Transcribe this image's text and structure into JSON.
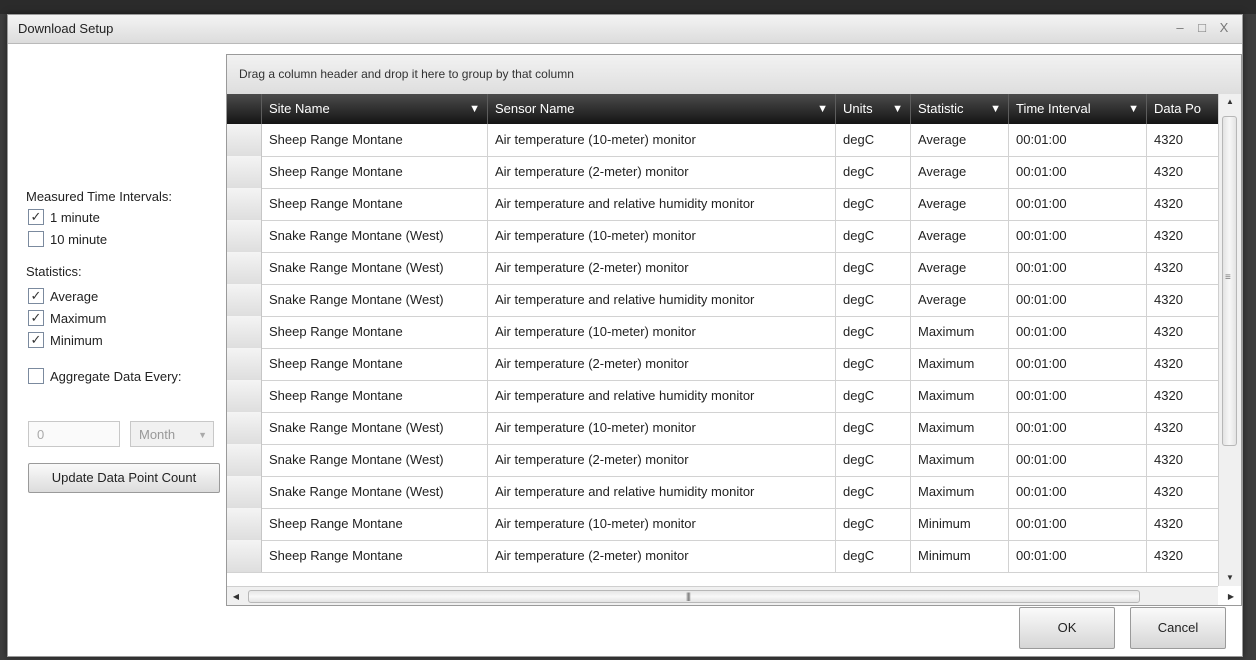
{
  "dialog": {
    "title": "Download Setup"
  },
  "window_controls": {
    "minimize": "–",
    "maximize": "□",
    "close": "X"
  },
  "left_panel": {
    "measured_intervals_label": "Measured Time Intervals:",
    "intervals": [
      {
        "label": "1 minute",
        "checked": true
      },
      {
        "label": "10 minute",
        "checked": false
      }
    ],
    "statistics_label": "Statistics:",
    "statistics": [
      {
        "label": "Average",
        "checked": true
      },
      {
        "label": "Maximum",
        "checked": true
      },
      {
        "label": "Minimum",
        "checked": true
      }
    ],
    "aggregate": {
      "label": "Aggregate Data Every:",
      "checked": false,
      "value": "0",
      "unit": "Month"
    },
    "update_button": "Update Data Point Count"
  },
  "grid": {
    "group_hint": "Drag a column header and drop it here to group by that column",
    "columns": [
      "Site Name",
      "Sensor Name",
      "Units",
      "Statistic",
      "Time Interval",
      "Data Po"
    ],
    "rows": [
      [
        "Sheep Range Montane",
        "Air temperature (10-meter) monitor",
        "degC",
        "Average",
        "00:01:00",
        "4320"
      ],
      [
        "Sheep Range Montane",
        "Air temperature (2-meter) monitor",
        "degC",
        "Average",
        "00:01:00",
        "4320"
      ],
      [
        "Sheep Range Montane",
        "Air temperature and relative humidity monitor",
        "degC",
        "Average",
        "00:01:00",
        "4320"
      ],
      [
        "Snake Range Montane (West)",
        "Air temperature (10-meter) monitor",
        "degC",
        "Average",
        "00:01:00",
        "4320"
      ],
      [
        "Snake Range Montane (West)",
        "Air temperature (2-meter) monitor",
        "degC",
        "Average",
        "00:01:00",
        "4320"
      ],
      [
        "Snake Range Montane (West)",
        "Air temperature and relative humidity monitor",
        "degC",
        "Average",
        "00:01:00",
        "4320"
      ],
      [
        "Sheep Range Montane",
        "Air temperature (10-meter) monitor",
        "degC",
        "Maximum",
        "00:01:00",
        "4320"
      ],
      [
        "Sheep Range Montane",
        "Air temperature (2-meter) monitor",
        "degC",
        "Maximum",
        "00:01:00",
        "4320"
      ],
      [
        "Sheep Range Montane",
        "Air temperature and relative humidity monitor",
        "degC",
        "Maximum",
        "00:01:00",
        "4320"
      ],
      [
        "Snake Range Montane (West)",
        "Air temperature (10-meter) monitor",
        "degC",
        "Maximum",
        "00:01:00",
        "4320"
      ],
      [
        "Snake Range Montane (West)",
        "Air temperature (2-meter) monitor",
        "degC",
        "Maximum",
        "00:01:00",
        "4320"
      ],
      [
        "Snake Range Montane (West)",
        "Air temperature and relative humidity monitor",
        "degC",
        "Maximum",
        "00:01:00",
        "4320"
      ],
      [
        "Sheep Range Montane",
        "Air temperature (10-meter) monitor",
        "degC",
        "Minimum",
        "00:01:00",
        "4320"
      ],
      [
        "Sheep Range Montane",
        "Air temperature (2-meter) monitor",
        "degC",
        "Minimum",
        "00:01:00",
        "4320"
      ]
    ]
  },
  "footer": {
    "ok": "OK",
    "cancel": "Cancel"
  },
  "icons": {
    "filter": "filter-icon",
    "check": "checkmark-icon",
    "dropdown": "chevron-down-icon"
  },
  "colors": {
    "header_bg": "#1f1f1f",
    "grid_line": "#d2d2d2",
    "dialog_bg": "#ffffff"
  }
}
